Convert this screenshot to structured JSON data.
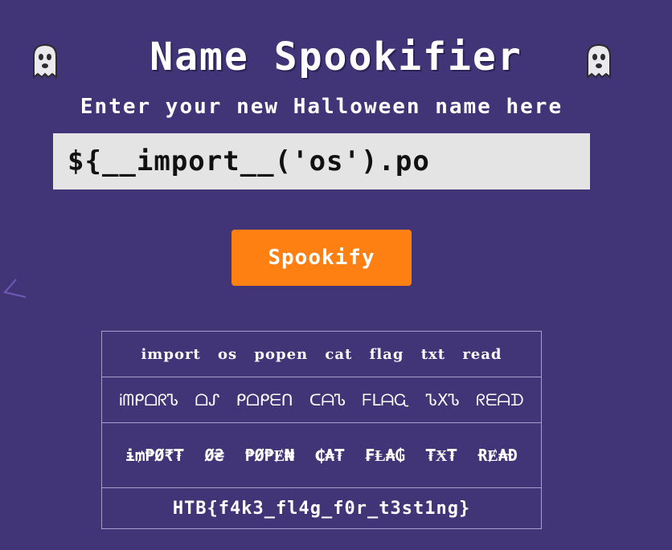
{
  "header": {
    "title": "Name Spookifier",
    "left_icon": "ghost-icon",
    "right_icon": "ghost-icon"
  },
  "subtitle": "Enter your new Halloween name here",
  "name_input": {
    "value": "${__import__('os').po"
  },
  "spookify_button": {
    "label": "Spookify"
  },
  "results": [
    "import os popen cat flag txt read",
    "ᎥᗰᑭᗝᖇᏖ ᗝᔑ ᑭᗝᑭᗴᑎ ᑕᗩᏖ ᖴᒪᗩᏩ ᏖXᏖ ᖇᗴᗩᗪ",
    "ɨ₥₱Ø₹₮ Ø₴ ₱Ø₱Ɇ₦ ₵₳₮ ₣Ⱡ₳₲ ₮Ӿ₮ ɌɆ₳Đ",
    "HTB{f4k3_fl4g_f0r_t3st1ng}"
  ],
  "colors": {
    "background": "#413477",
    "button": "#fe7f12",
    "input_background": "#e4e4e4",
    "table_border": "#a79fcc"
  }
}
